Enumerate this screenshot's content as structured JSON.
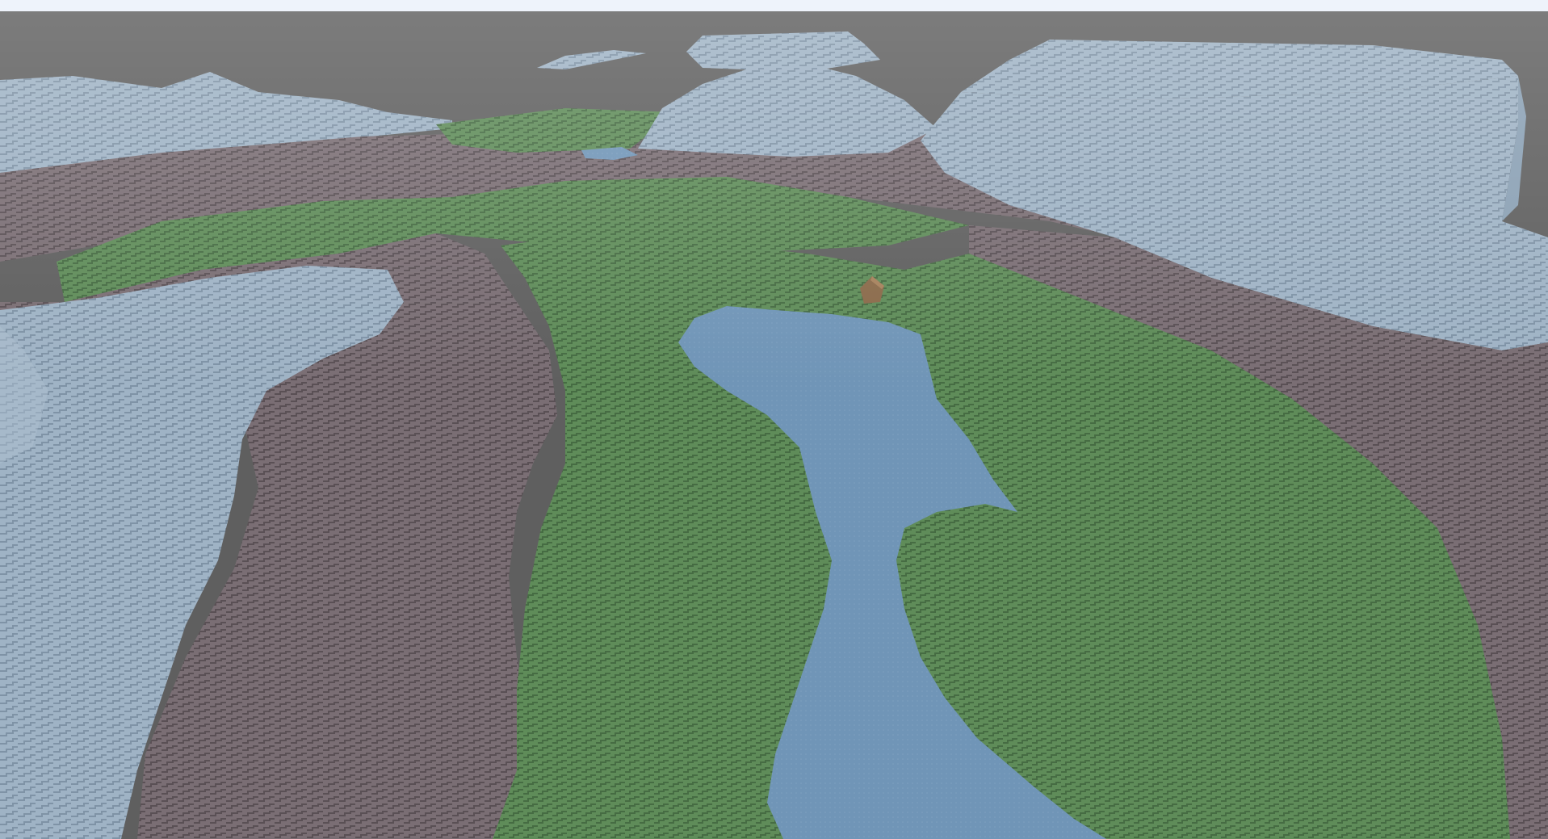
{
  "scene": {
    "kind": "voxel terrain 3D viewport",
    "colors": {
      "background": "#5f5f5f",
      "top_strip": "#eef3fb",
      "snow_rock": "#93a8ba",
      "snow_rock_light": "#aec0d0",
      "dirt": "#786c72",
      "dirt_dark": "#5f555a",
      "grass": "#5d8a57",
      "grass_light": "#6d9b64",
      "water": "#6f93b5",
      "cabin": "#8a6a4a"
    },
    "objects": [
      {
        "name": "lake",
        "material": "water"
      },
      {
        "name": "cabin",
        "material": "wood"
      },
      {
        "name": "left-ridge",
        "material": "snow_rock"
      },
      {
        "name": "right-plateau",
        "material": "snow_rock"
      },
      {
        "name": "back-mountains",
        "material": "snow_rock"
      },
      {
        "name": "grass-valley",
        "material": "grass"
      }
    ]
  }
}
